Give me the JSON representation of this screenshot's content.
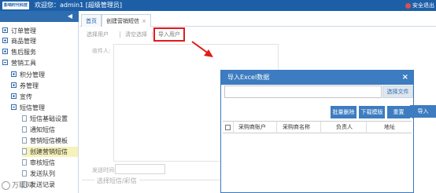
{
  "header": {
    "logo_text": "影响时代科技",
    "welcome_text": "欢迎您：admin1 [超级管理员]",
    "logout_label": "安全退出"
  },
  "sidebar": {
    "toggle_symbol": "◀",
    "items": [
      {
        "label": "订单管理",
        "type": "folder",
        "state": "collapsed"
      },
      {
        "label": "商品管理",
        "type": "folder",
        "state": "collapsed"
      },
      {
        "label": "售后服务",
        "type": "folder",
        "state": "collapsed"
      },
      {
        "label": "营销工具",
        "type": "folder",
        "state": "expanded"
      },
      {
        "label": "积分管理",
        "type": "folder",
        "state": "collapsed"
      },
      {
        "label": "券管理",
        "type": "folder",
        "state": "collapsed"
      },
      {
        "label": "宣传",
        "type": "folder",
        "state": "collapsed"
      },
      {
        "label": "短信管理",
        "type": "folder",
        "state": "expanded"
      },
      {
        "label": "短信基础设置",
        "type": "page"
      },
      {
        "label": "通知短信",
        "type": "page"
      },
      {
        "label": "营销短信模板",
        "type": "page"
      },
      {
        "label": "创建营销短信",
        "type": "page",
        "active": true
      },
      {
        "label": "审核短信",
        "type": "page"
      },
      {
        "label": "发送队列",
        "type": "page"
      },
      {
        "label": "发送记录",
        "type": "page"
      }
    ]
  },
  "tabs": [
    {
      "label": "首页",
      "active": false
    },
    {
      "label": "创建营销短信",
      "active": true,
      "close": "×"
    }
  ],
  "toolbar": {
    "select_user": "选择用户",
    "clear_selection": "清空选择",
    "import_user": "导入用户"
  },
  "form": {
    "recipient_label": "收件人:",
    "send_time_label": "发送时间:",
    "send_time_value": "",
    "template_legend": "选择短信/彩信"
  },
  "dialog": {
    "title": "导入Excel数据",
    "close": "×",
    "file_value": "",
    "select_file": "选择文件",
    "buttons": {
      "batch_delete": "批量删除",
      "download_template": "下载模版",
      "reset": "重置",
      "import": "导入"
    },
    "columns": [
      "采购商账户",
      "采购商名称",
      "负责人",
      "地址"
    ]
  },
  "watermark_text": "万联网"
}
